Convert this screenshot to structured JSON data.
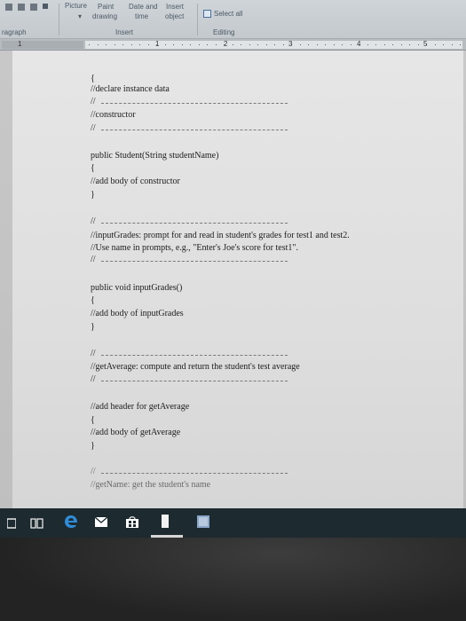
{
  "ribbon": {
    "picture_label": "Picture",
    "paint_label": "Paint",
    "drawing_label": "drawing",
    "date_and_label": "Date and",
    "time_label": "time",
    "insert_label": "Insert",
    "object_label": "object",
    "select_all_label": "Select all",
    "group_paragraph": "ragraph",
    "group_insert": "Insert",
    "group_editing": "Editing"
  },
  "ruler": {
    "marks": [
      "1",
      "1",
      "2",
      "3",
      "4",
      "5"
    ]
  },
  "document": {
    "lines": [
      "{",
      "//declare instance data",
      "//",
      "//constructor",
      "//",
      "public Student(String studentName)",
      "{",
      "//add body of constructor",
      "}",
      "//",
      "//inputGrades: prompt for and read in student's grades for test1 and test2.",
      "//Use name in prompts, e.g., \"Enter's Joe's score for test1\".",
      "//",
      "public void inputGrades()",
      "{",
      "//add body of inputGrades",
      "}",
      "//",
      "//getAverage: compute and return the student's test average",
      "//",
      "//add header for getAverage",
      "{",
      "//add body of getAverage",
      "}",
      "//",
      "//getName: get the student's name"
    ]
  },
  "taskbar": {
    "icons": [
      "file-explorer-icon",
      "task-view-icon",
      "edge-icon",
      "mail-icon",
      "store-icon",
      "word-icon",
      "app-icon"
    ]
  }
}
